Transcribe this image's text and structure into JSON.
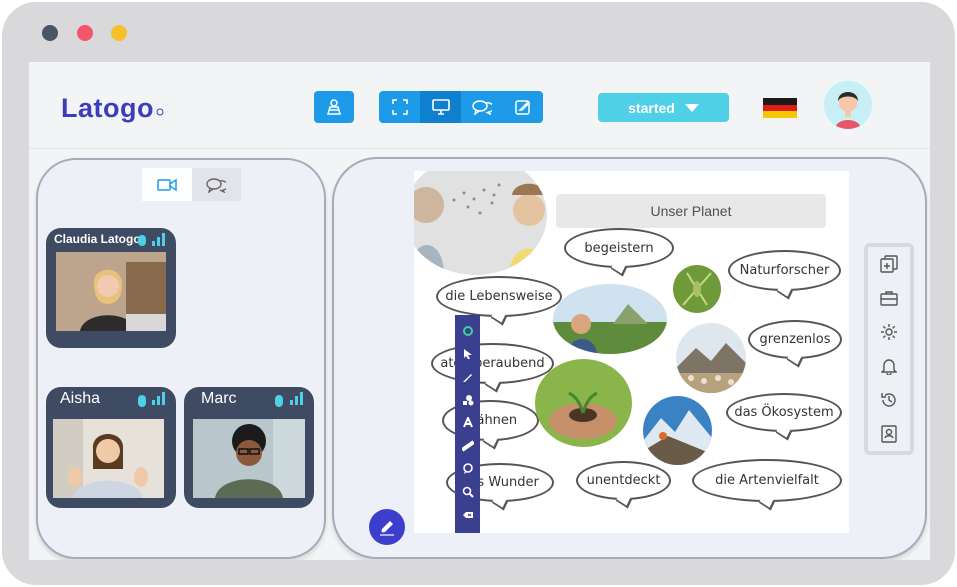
{
  "window": {
    "dots": [
      "#4a5568",
      "#f5556b",
      "#f7c02b"
    ]
  },
  "header": {
    "logo_text": "Latogo",
    "mode_buttons": [
      "fullscreen-icon",
      "monitor-icon",
      "chat-icon",
      "edit-icon"
    ],
    "status_label": "started",
    "language_flag": "de"
  },
  "left_panel": {
    "tabs": [
      "video-icon",
      "chat-icon"
    ],
    "participants": [
      {
        "name": "Claudia Latogo"
      },
      {
        "name": "Aisha"
      },
      {
        "name": "Marc"
      }
    ]
  },
  "slide": {
    "title": "Unser Planet",
    "bubbles": [
      "begeistern",
      "Naturforscher",
      "die Lebensweise",
      "grenzenlos",
      "atemberaubend",
      "das Ökosystem",
      "mähnen",
      "das Wunder",
      "unentdeckt",
      "die Artenvielfalt"
    ]
  },
  "drawing_tools": [
    "circle-tool",
    "pointer-tool",
    "pen-tool",
    "shapes-tool",
    "text-tool",
    "ruler-tool",
    "comment-tool",
    "zoom-tool",
    "eraser-tool"
  ],
  "side_tools": [
    "add-slide-icon",
    "briefcase-icon",
    "gear-icon",
    "bell-icon",
    "history-icon",
    "contact-icon"
  ],
  "colors": {
    "accent": "#1d9be8",
    "status": "#4fd0e6",
    "toolbar": "#3a3f8f",
    "card": "#3f4b62"
  }
}
